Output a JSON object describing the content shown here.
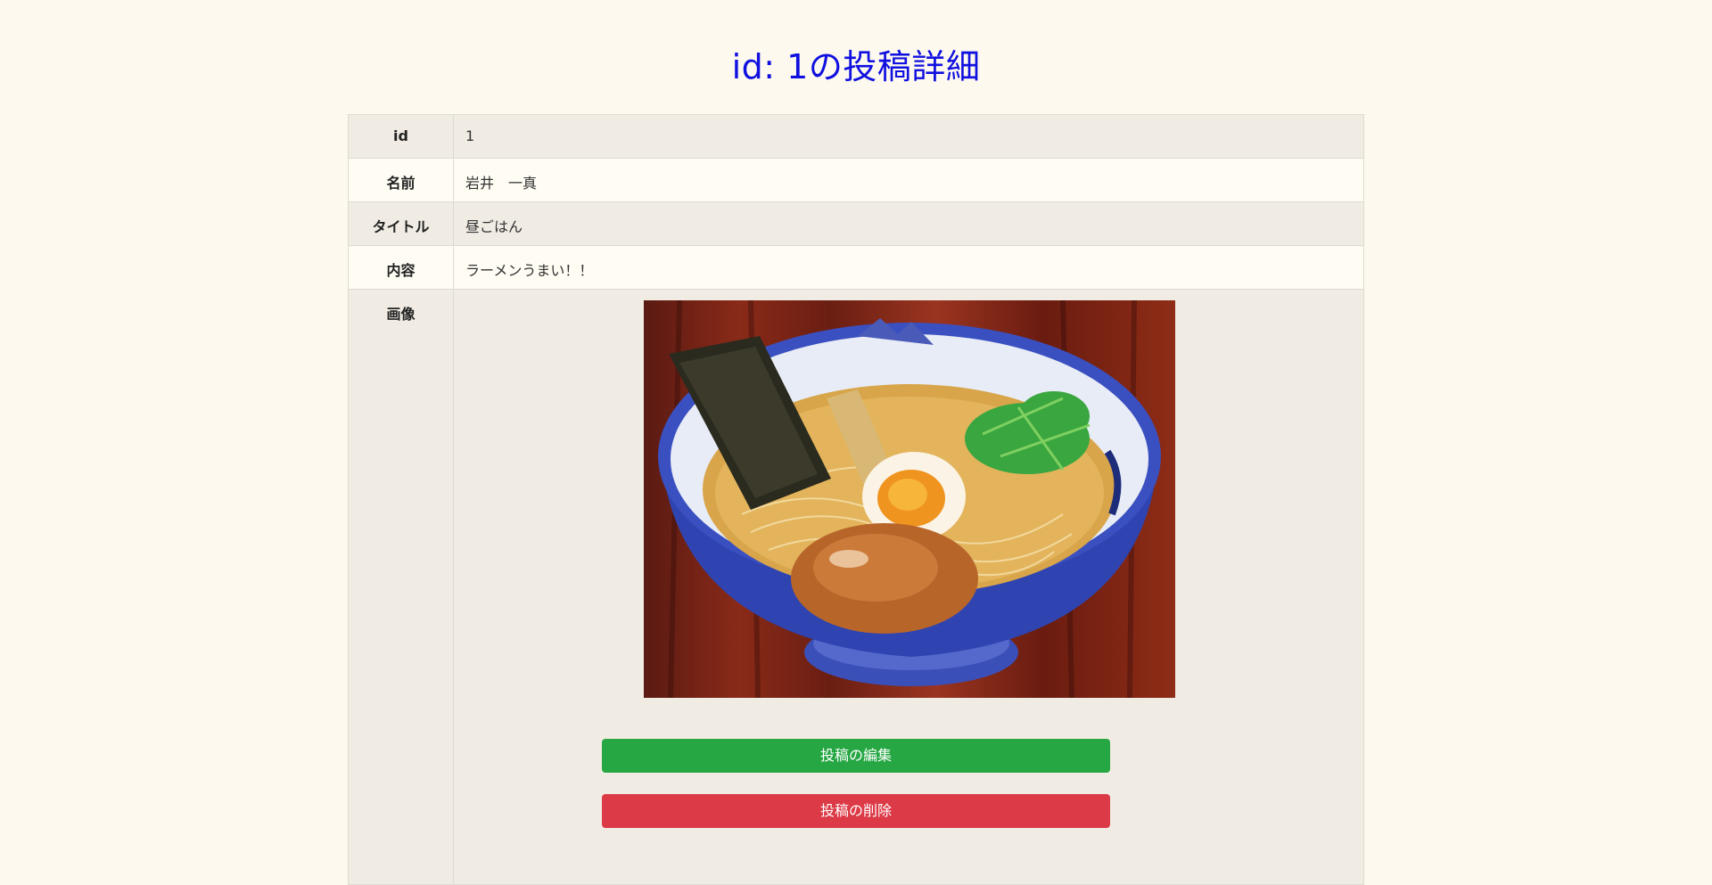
{
  "page": {
    "title": "id: 1の投稿詳細"
  },
  "post": {
    "rows": [
      {
        "label": "id",
        "value": "1"
      },
      {
        "label": "名前",
        "value": "岩井　一真"
      },
      {
        "label": "タイトル",
        "value": "昼ごはん"
      },
      {
        "label": "内容",
        "value": "ラーメンうまい！！"
      }
    ],
    "image_label": "画像",
    "image_subject": "ramen-bowl"
  },
  "actions": {
    "edit_label": "投稿の編集",
    "delete_label": "投稿の削除"
  },
  "colors": {
    "title": "#1010e0",
    "edit_button": "#26a744",
    "delete_button": "#dc3a46",
    "page_background": "#fdf9ee"
  }
}
